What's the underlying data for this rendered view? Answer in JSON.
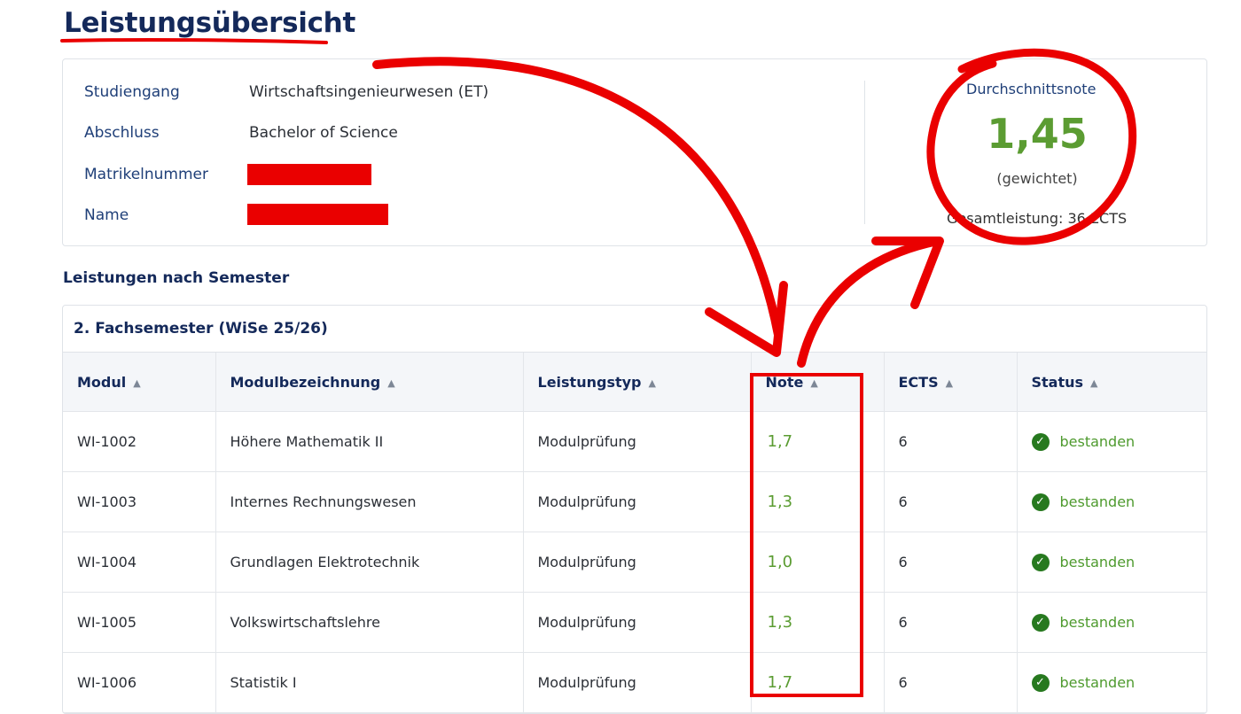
{
  "page_title": "Leistungsübersicht",
  "info": {
    "fields": [
      {
        "label": "Studiengang",
        "value": "Wirtschaftsingenieurwesen (ET)"
      },
      {
        "label": "Abschluss",
        "value": "Bachelor of Science"
      },
      {
        "label": "Matrikelnummer",
        "value": ""
      },
      {
        "label": "Name",
        "value": ""
      }
    ],
    "average_label": "Durchschnittsnote",
    "average_value": "1,45",
    "average_sub": "(gewichtet)",
    "total": "Gesamtleistung: 36 ECTS"
  },
  "section_title": "Leistungen nach Semester",
  "semester": {
    "title": "2. Fachsemester (WiSe 25/26)",
    "columns": [
      "Modul",
      "Modulbezeichnung",
      "Leistungstyp",
      "Note",
      "ECTS",
      "Status"
    ],
    "rows": [
      {
        "modul": "WI-1002",
        "bezeichnung": "Höhere Mathematik II",
        "typ": "Modulprüfung",
        "note": "1,7",
        "ects": "6",
        "status": "bestanden"
      },
      {
        "modul": "WI-1003",
        "bezeichnung": "Internes Rechnungswesen",
        "typ": "Modulprüfung",
        "note": "1,3",
        "ects": "6",
        "status": "bestanden"
      },
      {
        "modul": "WI-1004",
        "bezeichnung": "Grundlagen Elektrotechnik",
        "typ": "Modulprüfung",
        "note": "1,0",
        "ects": "6",
        "status": "bestanden"
      },
      {
        "modul": "WI-1005",
        "bezeichnung": "Volkswirtschaftslehre",
        "typ": "Modulprüfung",
        "note": "1,3",
        "ects": "6",
        "status": "bestanden"
      },
      {
        "modul": "WI-1006",
        "bezeichnung": "Statistik I",
        "typ": "Modulprüfung",
        "note": "1,7",
        "ects": "6",
        "status": "bestanden"
      }
    ]
  },
  "colors": {
    "title": "#14295a",
    "label": "#1f3f78",
    "grade_green": "#5b9c32",
    "status_green": "#27791f",
    "annotation_red": "#ea0000"
  },
  "icons": {
    "sort": "sort-icon",
    "status": "check-circle-icon"
  }
}
